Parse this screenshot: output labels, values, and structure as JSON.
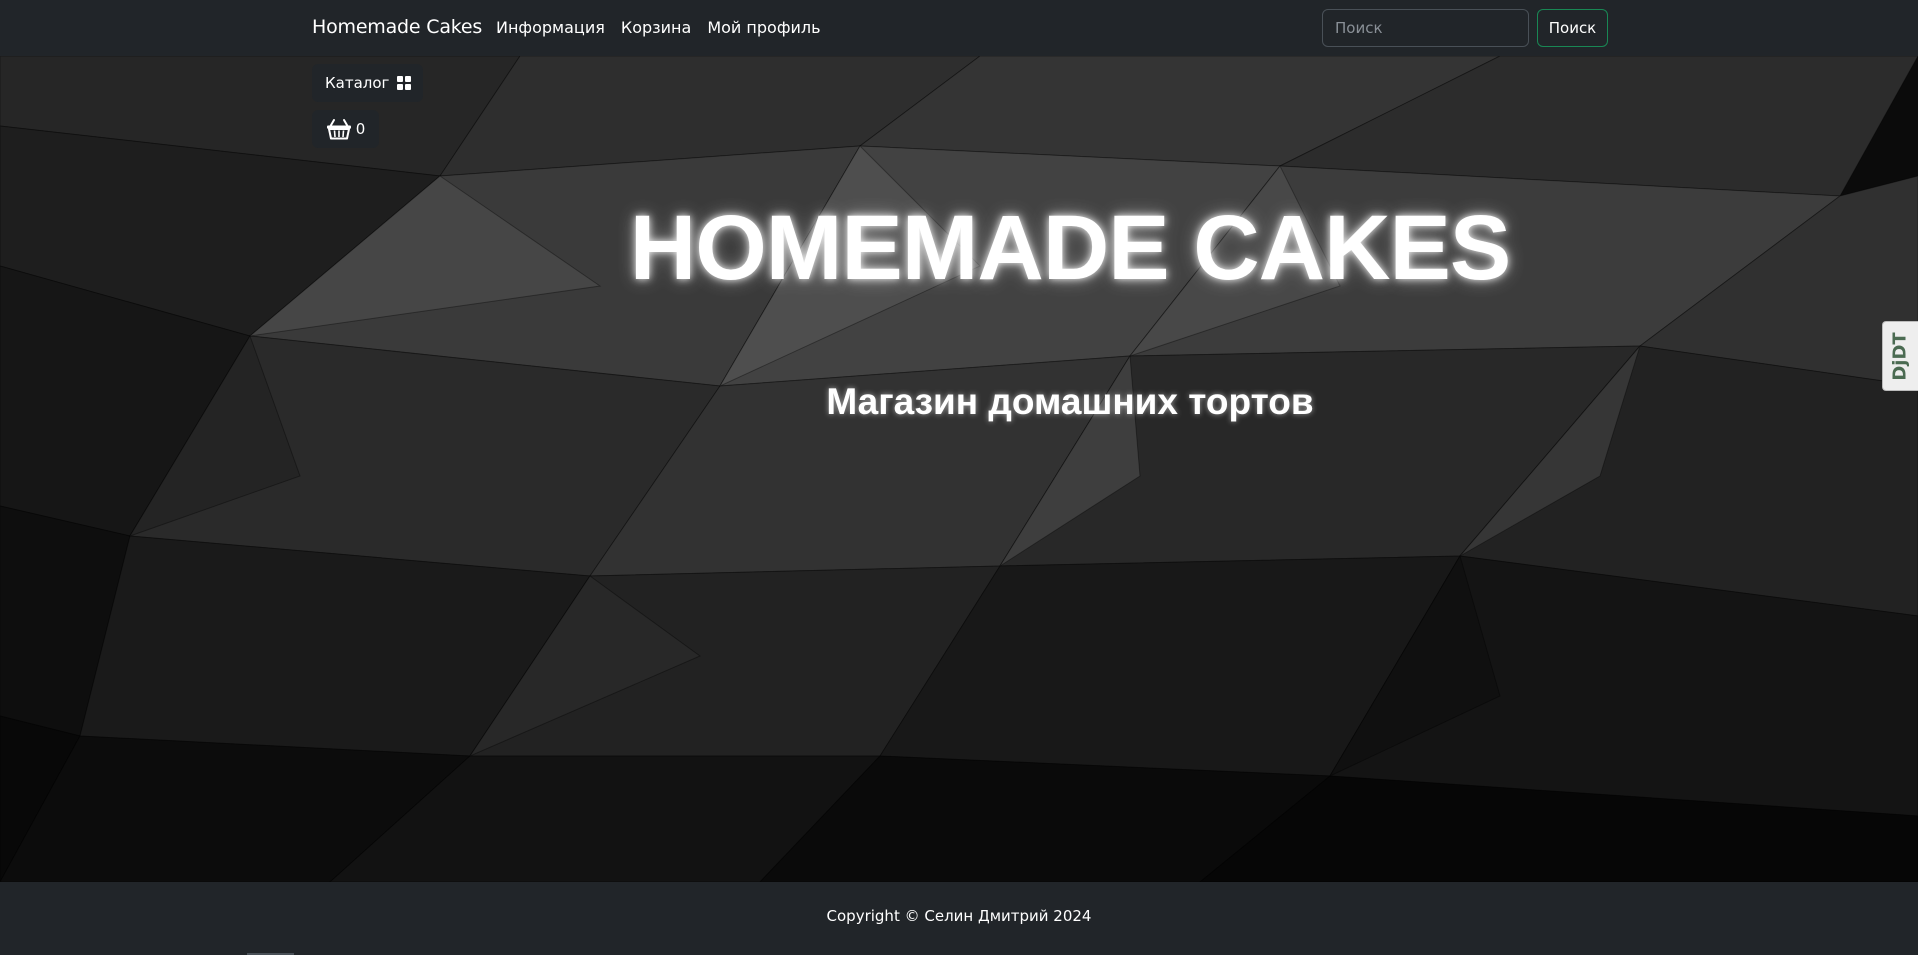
{
  "navbar": {
    "brand": "Homemade Cakes",
    "links": [
      "Информация",
      "Корзина",
      "Мой профиль"
    ],
    "search": {
      "placeholder": "Поиск",
      "value": "",
      "button_label": "Поиск"
    },
    "background_color": "#212529"
  },
  "hero": {
    "catalog_button": {
      "label": "Каталог",
      "icon": "grid-icon"
    },
    "cart_button": {
      "icon": "basket-icon",
      "count": "0"
    },
    "title": "HOMEMADE CAKES",
    "subtitle": "Магазин домашних тортов",
    "background": "dark low-poly geometric pattern"
  },
  "debug_toolbar": {
    "label": "DjDT"
  },
  "footer": {
    "copyright": "Copyright © Селин Дмитрий 2024"
  },
  "colors": {
    "dark_panel": "#212529",
    "accent_green": "#198754",
    "text": "#ffffff"
  }
}
